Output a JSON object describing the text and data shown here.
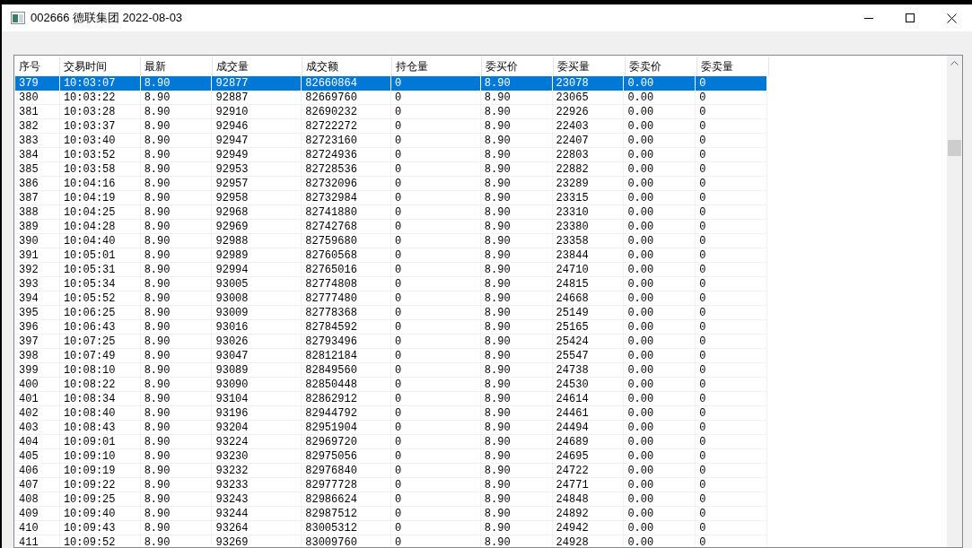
{
  "window": {
    "title": "002666 德联集团 2022-08-03"
  },
  "table": {
    "columns": [
      "序号",
      "交易时间",
      "最新",
      "成交量",
      "成交额",
      "持仓量",
      "委买价",
      "委买量",
      "委卖价",
      "委卖量"
    ],
    "rows": [
      {
        "selected": true,
        "cells": [
          "379",
          "10:03:07",
          "8.90",
          "92877",
          "82660864",
          "0",
          "8.90",
          "23078",
          "0.00",
          "0"
        ]
      },
      {
        "selected": false,
        "cells": [
          "380",
          "10:03:22",
          "8.90",
          "92887",
          "82669760",
          "0",
          "8.90",
          "23065",
          "0.00",
          "0"
        ]
      },
      {
        "selected": false,
        "cells": [
          "381",
          "10:03:28",
          "8.90",
          "92910",
          "82690232",
          "0",
          "8.90",
          "22926",
          "0.00",
          "0"
        ]
      },
      {
        "selected": false,
        "cells": [
          "382",
          "10:03:37",
          "8.90",
          "92946",
          "82722272",
          "0",
          "8.90",
          "22403",
          "0.00",
          "0"
        ]
      },
      {
        "selected": false,
        "cells": [
          "383",
          "10:03:40",
          "8.90",
          "92947",
          "82723160",
          "0",
          "8.90",
          "22407",
          "0.00",
          "0"
        ]
      },
      {
        "selected": false,
        "cells": [
          "384",
          "10:03:52",
          "8.90",
          "92949",
          "82724936",
          "0",
          "8.90",
          "22803",
          "0.00",
          "0"
        ]
      },
      {
        "selected": false,
        "cells": [
          "385",
          "10:03:58",
          "8.90",
          "92953",
          "82728536",
          "0",
          "8.90",
          "22882",
          "0.00",
          "0"
        ]
      },
      {
        "selected": false,
        "cells": [
          "386",
          "10:04:16",
          "8.90",
          "92957",
          "82732096",
          "0",
          "8.90",
          "23289",
          "0.00",
          "0"
        ]
      },
      {
        "selected": false,
        "cells": [
          "387",
          "10:04:19",
          "8.90",
          "92958",
          "82732984",
          "0",
          "8.90",
          "23315",
          "0.00",
          "0"
        ]
      },
      {
        "selected": false,
        "cells": [
          "388",
          "10:04:25",
          "8.90",
          "92968",
          "82741880",
          "0",
          "8.90",
          "23310",
          "0.00",
          "0"
        ]
      },
      {
        "selected": false,
        "cells": [
          "389",
          "10:04:28",
          "8.90",
          "92969",
          "82742768",
          "0",
          "8.90",
          "23380",
          "0.00",
          "0"
        ]
      },
      {
        "selected": false,
        "cells": [
          "390",
          "10:04:40",
          "8.90",
          "92988",
          "82759680",
          "0",
          "8.90",
          "23358",
          "0.00",
          "0"
        ]
      },
      {
        "selected": false,
        "cells": [
          "391",
          "10:05:01",
          "8.90",
          "92989",
          "82760568",
          "0",
          "8.90",
          "23844",
          "0.00",
          "0"
        ]
      },
      {
        "selected": false,
        "cells": [
          "392",
          "10:05:31",
          "8.90",
          "92994",
          "82765016",
          "0",
          "8.90",
          "24710",
          "0.00",
          "0"
        ]
      },
      {
        "selected": false,
        "cells": [
          "393",
          "10:05:34",
          "8.90",
          "93005",
          "82774808",
          "0",
          "8.90",
          "24815",
          "0.00",
          "0"
        ]
      },
      {
        "selected": false,
        "cells": [
          "394",
          "10:05:52",
          "8.90",
          "93008",
          "82777480",
          "0",
          "8.90",
          "24668",
          "0.00",
          "0"
        ]
      },
      {
        "selected": false,
        "cells": [
          "395",
          "10:06:25",
          "8.90",
          "93009",
          "82778368",
          "0",
          "8.90",
          "25149",
          "0.00",
          "0"
        ]
      },
      {
        "selected": false,
        "cells": [
          "396",
          "10:06:43",
          "8.90",
          "93016",
          "82784592",
          "0",
          "8.90",
          "25165",
          "0.00",
          "0"
        ]
      },
      {
        "selected": false,
        "cells": [
          "397",
          "10:07:25",
          "8.90",
          "93026",
          "82793496",
          "0",
          "8.90",
          "25424",
          "0.00",
          "0"
        ]
      },
      {
        "selected": false,
        "cells": [
          "398",
          "10:07:49",
          "8.90",
          "93047",
          "82812184",
          "0",
          "8.90",
          "25547",
          "0.00",
          "0"
        ]
      },
      {
        "selected": false,
        "cells": [
          "399",
          "10:08:10",
          "8.90",
          "93089",
          "82849560",
          "0",
          "8.90",
          "24738",
          "0.00",
          "0"
        ]
      },
      {
        "selected": false,
        "cells": [
          "400",
          "10:08:22",
          "8.90",
          "93090",
          "82850448",
          "0",
          "8.90",
          "24530",
          "0.00",
          "0"
        ]
      },
      {
        "selected": false,
        "cells": [
          "401",
          "10:08:34",
          "8.90",
          "93104",
          "82862912",
          "0",
          "8.90",
          "24614",
          "0.00",
          "0"
        ]
      },
      {
        "selected": false,
        "cells": [
          "402",
          "10:08:40",
          "8.90",
          "93196",
          "82944792",
          "0",
          "8.90",
          "24461",
          "0.00",
          "0"
        ]
      },
      {
        "selected": false,
        "cells": [
          "403",
          "10:08:43",
          "8.90",
          "93204",
          "82951904",
          "0",
          "8.90",
          "24494",
          "0.00",
          "0"
        ]
      },
      {
        "selected": false,
        "cells": [
          "404",
          "10:09:01",
          "8.90",
          "93224",
          "82969720",
          "0",
          "8.90",
          "24689",
          "0.00",
          "0"
        ]
      },
      {
        "selected": false,
        "cells": [
          "405",
          "10:09:10",
          "8.90",
          "93230",
          "82975056",
          "0",
          "8.90",
          "24695",
          "0.00",
          "0"
        ]
      },
      {
        "selected": false,
        "cells": [
          "406",
          "10:09:19",
          "8.90",
          "93232",
          "82976840",
          "0",
          "8.90",
          "24722",
          "0.00",
          "0"
        ]
      },
      {
        "selected": false,
        "cells": [
          "407",
          "10:09:22",
          "8.90",
          "93233",
          "82977728",
          "0",
          "8.90",
          "24771",
          "0.00",
          "0"
        ]
      },
      {
        "selected": false,
        "cells": [
          "408",
          "10:09:25",
          "8.90",
          "93243",
          "82986624",
          "0",
          "8.90",
          "24848",
          "0.00",
          "0"
        ]
      },
      {
        "selected": false,
        "cells": [
          "409",
          "10:09:40",
          "8.90",
          "93244",
          "82987512",
          "0",
          "8.90",
          "24892",
          "0.00",
          "0"
        ]
      },
      {
        "selected": false,
        "cells": [
          "410",
          "10:09:43",
          "8.90",
          "93264",
          "83005312",
          "0",
          "8.90",
          "24942",
          "0.00",
          "0"
        ]
      },
      {
        "selected": false,
        "cells": [
          "411",
          "10:09:52",
          "8.90",
          "93269",
          "83009760",
          "0",
          "8.90",
          "24928",
          "0.00",
          "0"
        ]
      }
    ]
  }
}
